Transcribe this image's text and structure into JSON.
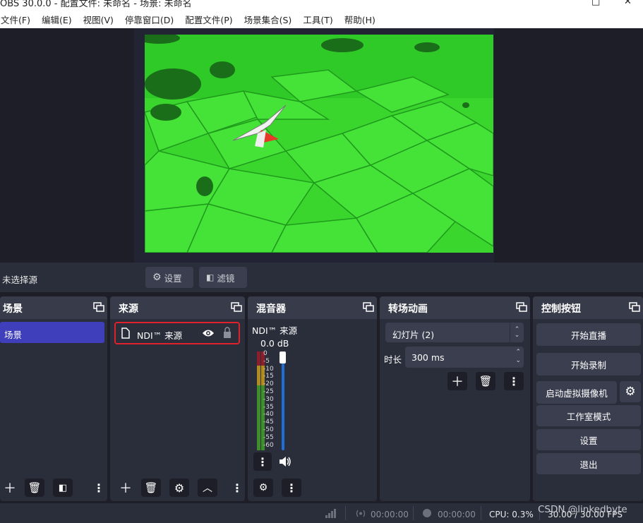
{
  "window": {
    "title": "OBS 30.0.0 - 配置文件: 未命名 - 场景: 未命名",
    "maximize_icon": "maximize-icon",
    "close_icon": "close-icon"
  },
  "menu": [
    "文件(F)",
    "编辑(E)",
    "视图(V)",
    "停靠窗口(D)",
    "配置文件(P)",
    "场景集合(S)",
    "工具(T)",
    "帮助(H)"
  ],
  "source_toolbar": {
    "no_source": "未选择源",
    "properties_label": "设置",
    "filters_label": "滤镜"
  },
  "scenes": {
    "title": "场景",
    "items": [
      "场景"
    ]
  },
  "sources": {
    "title": "来源",
    "items": [
      "NDI™ 来源"
    ]
  },
  "mixer": {
    "title": "混音器",
    "source_name": "NDI™ 来源",
    "db": "0.0 dB",
    "scale": [
      "0",
      "-5",
      "-10",
      "-15",
      "-20",
      "-25",
      "-30",
      "-35",
      "-40",
      "-45",
      "-50",
      "-55",
      "-60"
    ],
    "volume_level": 1.0
  },
  "transitions": {
    "title": "转场动画",
    "selected": "幻灯片 (2)",
    "duration_label": "时长",
    "duration_value": "300 ms"
  },
  "controls": {
    "title": "控制按钮",
    "start_streaming": "开始直播",
    "start_recording": "开始录制",
    "start_virtual_cam": "启动虚拟摄像机",
    "studio_mode": "工作室模式",
    "settings": "设置",
    "exit": "退出"
  },
  "status": {
    "stream_time": "00:00:00",
    "record_time": "00:00:00",
    "cpu": "CPU: 0.3%",
    "fps": "30.00 / 30.00 FPS"
  },
  "watermark": "CSDN @linkedbyte",
  "colors": {
    "accent": "#3f3fbc",
    "highlight_border": "#e0202a",
    "background": "#1d1e28",
    "panel": "#2a2d3a"
  }
}
